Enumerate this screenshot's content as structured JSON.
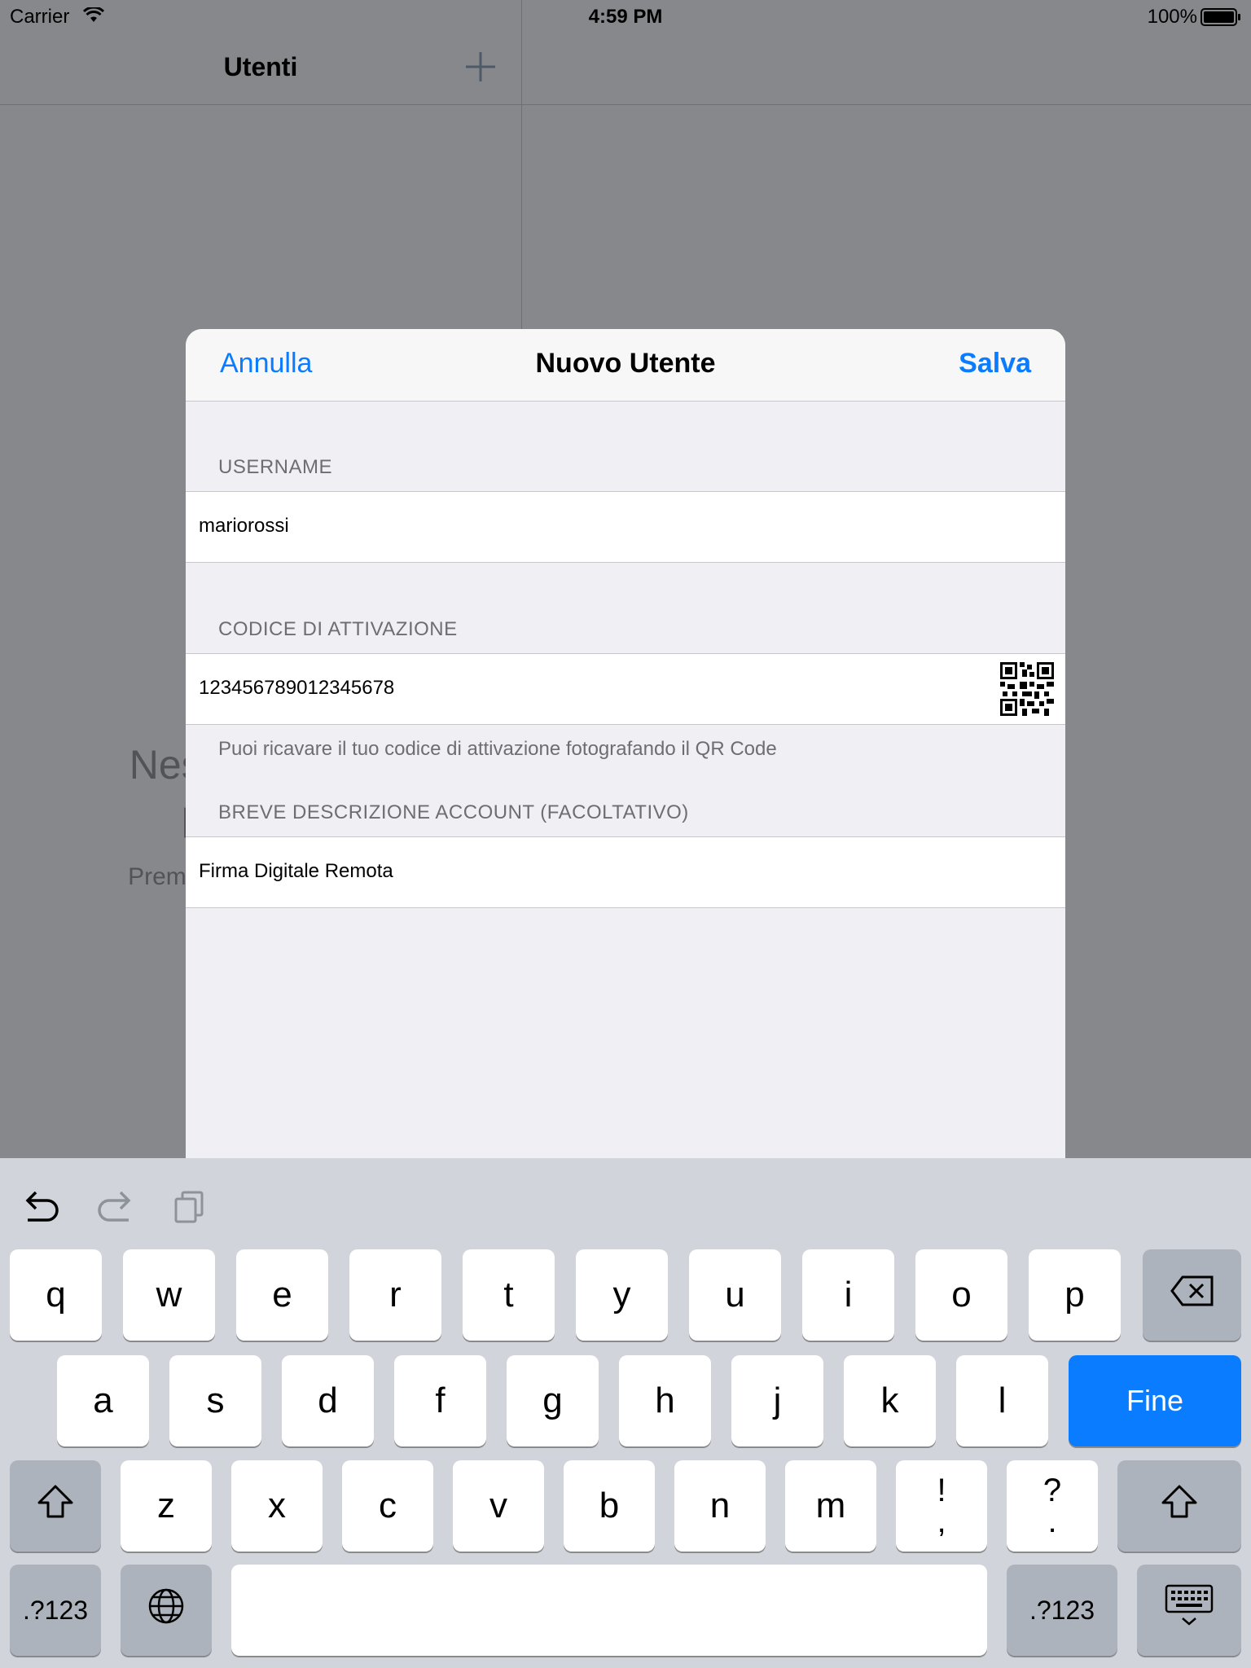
{
  "status_bar": {
    "carrier": "Carrier",
    "time": "4:59 PM",
    "battery": "100%"
  },
  "master": {
    "title": "Utenti",
    "empty_title_line1": "Nessun utente",
    "empty_title_line2": "presente",
    "empty_subtitle": "Premi '+' per aggiungere"
  },
  "sheet": {
    "cancel_label": "Annulla",
    "title": "Nuovo Utente",
    "save_label": "Salva",
    "username_header": "USERNAME",
    "username_value": "mariorossi",
    "activation_header": "CODICE DI ATTIVAZIONE",
    "activation_value": "123456789012345678",
    "activation_footer": "Puoi ricavare il tuo codice di attivazione fotografando il QR Code",
    "description_header": "BREVE DESCRIZIONE ACCOUNT (FACOLTATIVO)",
    "description_value": "Firma Digitale Remota"
  },
  "keyboard": {
    "row1": [
      "q",
      "w",
      "e",
      "r",
      "t",
      "y",
      "u",
      "i",
      "o",
      "p"
    ],
    "row2": [
      "a",
      "s",
      "d",
      "f",
      "g",
      "h",
      "j",
      "k",
      "l"
    ],
    "row3": [
      "z",
      "x",
      "c",
      "v",
      "b",
      "n",
      "m"
    ],
    "punct1_top": "!",
    "punct1_bottom": ",",
    "punct2_top": "?",
    "punct2_bottom": ".",
    "done_label": "Fine",
    "numbers_label": ".?123"
  },
  "icons": {
    "wifi": "wifi-icon",
    "battery": "battery-icon",
    "add": "plus-icon",
    "qr": "qr-code-icon",
    "undo": "undo-icon",
    "redo": "redo-icon",
    "paste": "paste-icon",
    "delete": "delete-icon",
    "shift": "shift-icon",
    "globe": "globe-icon",
    "dismiss": "keyboard-dismiss-icon"
  },
  "colors": {
    "accent": "#0a7cff",
    "dim_background": "#87888c",
    "keyboard": "#d1d5db"
  }
}
